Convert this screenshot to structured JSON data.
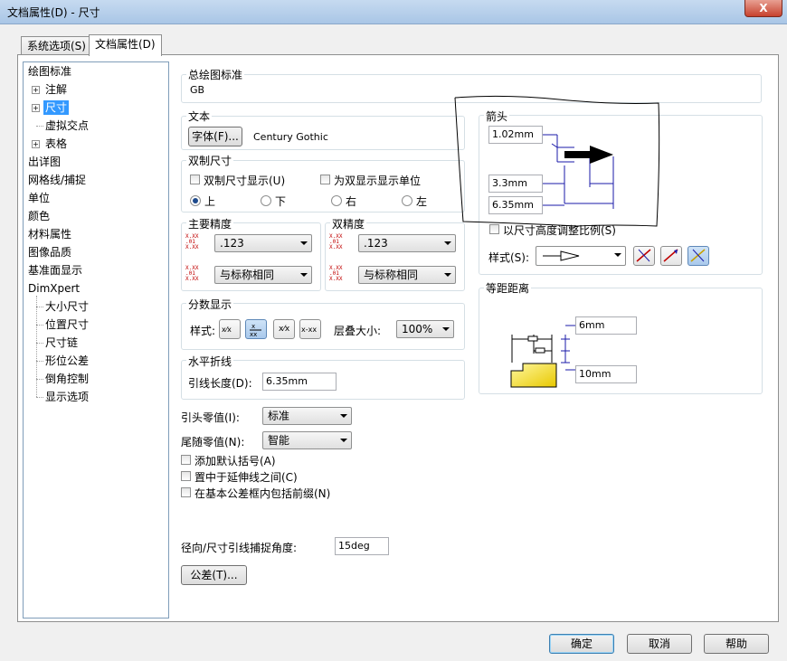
{
  "window": {
    "title": "文档属性(D) - 尺寸",
    "close_label": "X"
  },
  "tabs": [
    {
      "label": "系统选项(S)"
    },
    {
      "label": "文档属性(D)"
    }
  ],
  "tree": {
    "items": [
      {
        "label": "绘图标准"
      },
      {
        "label": "注解"
      },
      {
        "label": "尺寸"
      },
      {
        "label": "虚拟交点"
      },
      {
        "label": "表格"
      },
      {
        "label": "出详图"
      },
      {
        "label": "网格线/捕捉"
      },
      {
        "label": "单位"
      },
      {
        "label": "颜色"
      },
      {
        "label": "材料属性"
      },
      {
        "label": "图像品质"
      },
      {
        "label": "基准面显示"
      },
      {
        "label": "DimXpert"
      },
      {
        "label": "大小尺寸"
      },
      {
        "label": "位置尺寸"
      },
      {
        "label": "尺寸链"
      },
      {
        "label": "形位公差"
      },
      {
        "label": "倒角控制"
      },
      {
        "label": "显示选项"
      }
    ]
  },
  "overall_standard": {
    "label": "总绘图标准",
    "value": "GB"
  },
  "text": {
    "label": "文本",
    "font_button": "字体(F)...",
    "font_name": "Century Gothic"
  },
  "dual": {
    "label": "双制尺寸",
    "dual_display": "双制尺寸显示(U)",
    "show_units": "为双显示显示单位",
    "radios": [
      {
        "label": "上"
      },
      {
        "label": "下"
      },
      {
        "label": "右"
      },
      {
        "label": "左"
      }
    ]
  },
  "primary_precision": {
    "label": "主要精度",
    "value": ".123",
    "tolerance": "与标称相同"
  },
  "dual_precision": {
    "label": "双精度",
    "value": ".123",
    "tolerance": "与标称相同"
  },
  "fraction": {
    "label": "分数显示",
    "style_label": "样式:",
    "stack_label": "层叠大小:",
    "stack_value": "100%"
  },
  "bent_leader": {
    "label": "水平折线",
    "length_label": "引线长度(D):",
    "length_value": "6.35mm"
  },
  "leading_zeros": {
    "label": "引头零值(I):",
    "value": "标准"
  },
  "trailing_zeros": {
    "label": "尾随零值(N):",
    "value": "智能"
  },
  "checks": [
    {
      "label": "添加默认括号(A)"
    },
    {
      "label": "置中于延伸线之间(C)"
    },
    {
      "label": "在基本公差框内包括前缀(N)"
    }
  ],
  "snap_angle": {
    "label": "径向/尺寸引线捕捉角度:",
    "value": "15deg"
  },
  "tolerance_button": "公差(T)...",
  "arrows": {
    "label": "箭头",
    "width": "1.02mm",
    "height": "3.3mm",
    "length": "6.35mm",
    "scale_check": "以尺寸高度调整比例(S)",
    "style_label": "样式(S):"
  },
  "offset": {
    "label": "等距距离",
    "top": "6mm",
    "bottom": "10mm"
  },
  "footer": {
    "ok": "确定",
    "cancel": "取消",
    "help": "帮助"
  },
  "colors": {
    "accent": "#3399ff",
    "arrow_dim": "#1a1aa8",
    "part_fill": "#f2d600"
  },
  "icons": [
    "expand-icon",
    "precision-icon",
    "fraction-style-icon",
    "arrow-style-icon",
    "close-icon"
  ]
}
